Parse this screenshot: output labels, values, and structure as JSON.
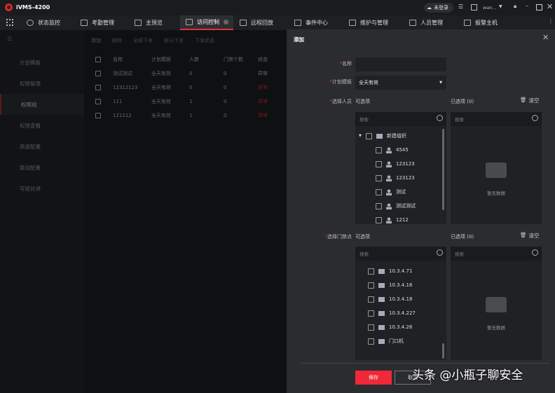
{
  "app": {
    "title": "iVMS-4200",
    "login_status": "未登录",
    "user": "wan..."
  },
  "nav": [
    {
      "label": "状态监控"
    },
    {
      "label": "考勤管理"
    },
    {
      "label": "主预览"
    },
    {
      "label": "访问控制"
    },
    {
      "label": "远程回放"
    },
    {
      "label": "事件中心"
    },
    {
      "label": "维护与管理"
    },
    {
      "label": "人员管理"
    },
    {
      "label": "报警主机"
    }
  ],
  "sidebar": [
    {
      "label": "计划模板"
    },
    {
      "label": "权限管理"
    },
    {
      "label": "权限组"
    },
    {
      "label": "权限查看"
    },
    {
      "label": "高级配置"
    },
    {
      "label": "联动配置"
    },
    {
      "label": "可视对讲"
    }
  ],
  "toolbar": {
    "add": "添加",
    "delete": "删除",
    "apply_all": "全部下发",
    "apply_part": "部分下发",
    "apply_status": "下发状态"
  },
  "table": {
    "headers": [
      "名称",
      "计划模板",
      "人数",
      "门禁个数",
      "状态"
    ],
    "rows": [
      [
        "测试测试",
        "全天有效",
        "0",
        "0",
        "异常"
      ],
      [
        "12312123",
        "全天有效",
        "0",
        "0",
        "异常"
      ],
      [
        "111",
        "全天有效",
        "1",
        "0",
        "异常"
      ],
      [
        "121212",
        "全天有效",
        "1",
        "0",
        "异常"
      ]
    ]
  },
  "dialog": {
    "title": "添加",
    "name_label": "名称",
    "name_value": "",
    "template_label": "计划模板",
    "template_value": "全天有效",
    "persons_label": "选择人员",
    "doors_label": "选择门禁点",
    "available": "可选项",
    "selected": "已选项 (0)",
    "clear": "清空",
    "search_placeholder": "搜索",
    "empty": "暂无数据",
    "org": "新建组织",
    "persons": [
      "4545",
      "123123",
      "123123",
      "测试",
      "测试测试",
      "1212"
    ],
    "doors": [
      "10.3.4.71",
      "10.3.4.16",
      "10.3.4.18",
      "10.3.4.227",
      "10.3.4.26",
      "门口机"
    ],
    "save": "保存",
    "cancel": "取消"
  },
  "watermark": "头条 @小瓶子聊安全",
  "colors": {
    "accent": "#e0303a"
  }
}
